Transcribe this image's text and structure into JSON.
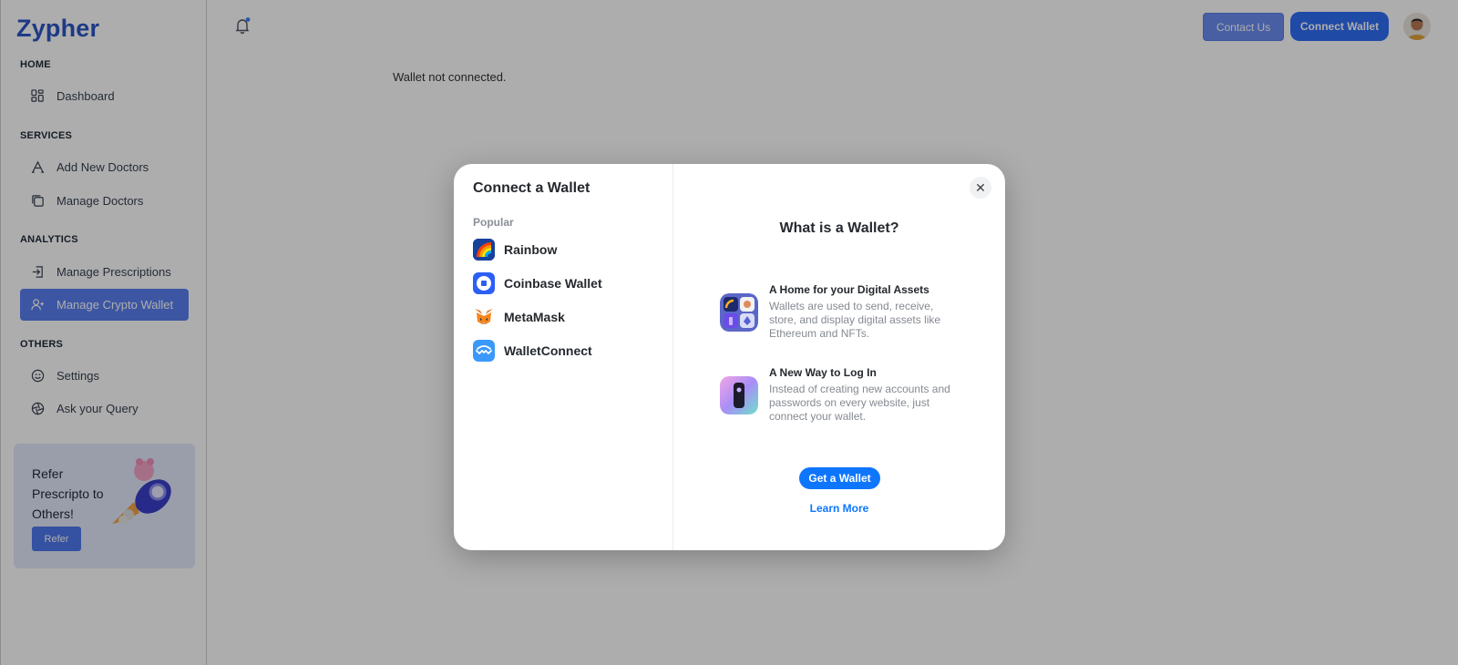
{
  "app": {
    "logo": "Zypher"
  },
  "sidebar": {
    "sections": [
      {
        "title": "HOME"
      },
      {
        "title": "SERVICES"
      },
      {
        "title": "ANALYTICS"
      },
      {
        "title": "OTHERS"
      }
    ],
    "items": [
      {
        "label": "Dashboard",
        "icon": "grid-icon"
      },
      {
        "label": "Add New Doctors",
        "icon": "letter-a-icon"
      },
      {
        "label": "Manage Doctors",
        "icon": "copy-icon"
      },
      {
        "label": "Manage Prescriptions",
        "icon": "login-icon"
      },
      {
        "label": "Manage Crypto Wallet",
        "icon": "user-plus-icon",
        "active": true
      },
      {
        "label": "Settings",
        "icon": "smile-icon"
      },
      {
        "label": "Ask your Query",
        "icon": "aperture-icon"
      }
    ],
    "refer": {
      "text": "Refer Prescripto to Others!",
      "button": "Refer"
    }
  },
  "topbar": {
    "contact_label": "Contact Us",
    "connect_label": "Connect Wallet"
  },
  "main": {
    "message": "Wallet not connected."
  },
  "modal": {
    "title": "Connect a Wallet",
    "group_label": "Popular",
    "wallets": [
      {
        "label": "Rainbow",
        "icon": "rainbow-icon"
      },
      {
        "label": "Coinbase Wallet",
        "icon": "coinbase-icon"
      },
      {
        "label": "MetaMask",
        "icon": "metamask-fox-icon"
      },
      {
        "label": "WalletConnect",
        "icon": "walletconnect-icon"
      }
    ],
    "close_label": "✕",
    "info_title": "What is a Wallet?",
    "features": [
      {
        "title": "A Home for your Digital Assets",
        "desc": "Wallets are used to send, receive, store, and display digital assets like Ethereum and NFTs."
      },
      {
        "title": "A New Way to Log In",
        "desc": "Instead of creating new accounts and passwords on every website, just connect your wallet."
      }
    ],
    "get_wallet_label": "Get a Wallet",
    "learn_more_label": "Learn More"
  },
  "colors": {
    "brand": "#2d56c6",
    "active_nav": "#5b7ff0",
    "primary_button": "#0e76fd"
  }
}
